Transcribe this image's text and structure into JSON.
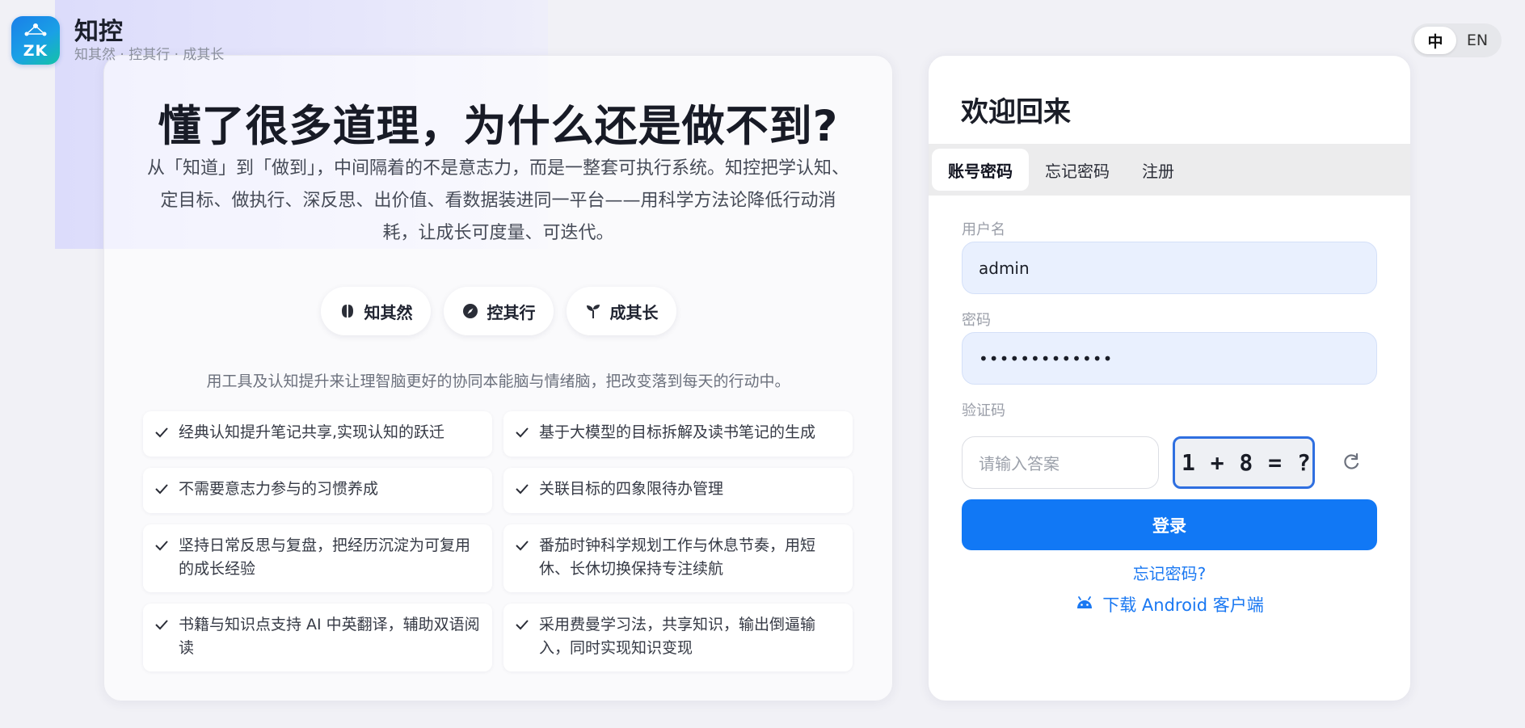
{
  "brand": {
    "name": "知控",
    "slogan": "知其然 · 控其行 · 成其长",
    "logo_text": "ZK"
  },
  "language": {
    "options": [
      "中",
      "EN"
    ],
    "selected": "中"
  },
  "hero": {
    "title": "懂了很多道理，为什么还是做不到?",
    "description": "从「知道」到「做到」，中间隔着的不是意志力，而是一整套可执行系统。知控把学认知、定目标、做执行、深反思、出价值、看数据装进同一平台——用科学方法论降低行动消耗，让成长可度量、可迭代。",
    "pills": [
      {
        "label": "知其然",
        "icon": "brain-icon"
      },
      {
        "label": "控其行",
        "icon": "compass-icon"
      },
      {
        "label": "成其长",
        "icon": "sprout-icon"
      }
    ],
    "subtitle": "用工具及认知提升来让理智脑更好的协同本能脑与情绪脑，把改变落到每天的行动中。",
    "features": [
      "经典认知提升笔记共享,实现认知的跃迁",
      "基于大模型的目标拆解及读书笔记的生成",
      "不需要意志力参与的习惯养成",
      "关联目标的四象限待办管理",
      "坚持日常反思与复盘，把经历沉淀为可复用的成长经验",
      "番茄时钟科学规划工作与休息节奏，用短休、长休切换保持专注续航",
      "书籍与知识点支持 AI 中英翻译，辅助双语阅读",
      "采用费曼学习法，共享知识，输出倒逼输入，同时实现知识变现"
    ]
  },
  "login": {
    "title": "欢迎回来",
    "tabs": [
      "账号密码",
      "忘记密码",
      "注册"
    ],
    "active_tab": "账号密码",
    "username_label": "用户名",
    "username_value": "admin",
    "password_label": "密码",
    "password_value": "•••••••••••••",
    "captcha_label": "验证码",
    "captcha_placeholder": "请输入答案",
    "captcha_question": "1 + 8 = ?",
    "submit_label": "登录",
    "forgot_link": "忘记密码?",
    "android_link": "下载 Android 客户端"
  },
  "colors": {
    "primary": "#1178f5",
    "link": "#1a78f2",
    "input_bg": "#e9f0fe",
    "page_bg": "#f1f1f6"
  }
}
